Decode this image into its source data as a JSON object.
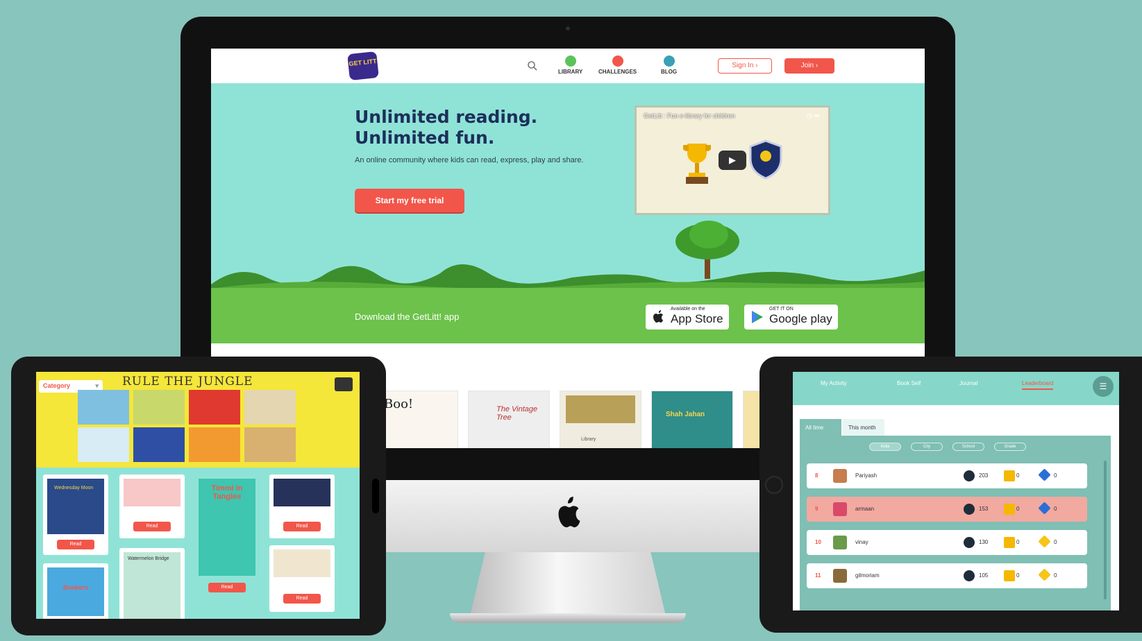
{
  "desktop": {
    "nav": {
      "logo_text": "GET LITT",
      "items": [
        {
          "label": "LIBRARY",
          "color": "#5cc35a"
        },
        {
          "label": "CHALLENGES",
          "color": "#f2564a"
        },
        {
          "label": "BLOG",
          "color": "#3aa0b5"
        }
      ],
      "sign_in": "Sign In ›",
      "join": "Join ›"
    },
    "hero": {
      "title_line1": "Unlimited reading.",
      "title_line2": "Unlimited fun.",
      "subtitle": "An online community where kids can read, express, play and share.",
      "cta": "Start my free trial",
      "video_title": "GetLitt : Fun e-library for children"
    },
    "download": {
      "text": "Download the GetLitt! app",
      "appstore_small": "Available on the",
      "appstore_big": "App Store",
      "googleplay_small": "GET IT ON",
      "googleplay_big": "Google play"
    },
    "book_strip": [
      "Boo!",
      "The Vintage Tree",
      "Library",
      "Shah Jahan",
      ""
    ]
  },
  "tablet_left": {
    "banner_title": "RULE THE JUNGLE",
    "category_label": "Category",
    "read_label": "Read",
    "cards": [
      "Wednesday Moon",
      "",
      "Timmi in Tangles",
      "",
      "Bonkers",
      "Watermelon Bridge",
      ""
    ]
  },
  "tablet_right": {
    "tabs": [
      "My Activity",
      "Book Self",
      "Journal",
      "Leaderboard"
    ],
    "periods": [
      "All time",
      "This month"
    ],
    "filters": [
      "India",
      "City",
      "School",
      "Grade"
    ],
    "rows": [
      {
        "rank": "8",
        "name": "Pariyash",
        "points": "203",
        "trophies": "0",
        "gems": "0",
        "gem_color": "#2b6fd6"
      },
      {
        "rank": "9",
        "name": "armaan",
        "points": "153",
        "trophies": "0",
        "gems": "0",
        "gem_color": "#2b6fd6"
      },
      {
        "rank": "10",
        "name": "vinay",
        "points": "130",
        "trophies": "0",
        "gems": "0",
        "gem_color": "#f5c518"
      },
      {
        "rank": "11",
        "name": "gilmoriam",
        "points": "105",
        "trophies": "0",
        "gems": "0",
        "gem_color": "#f5c518"
      }
    ]
  },
  "colors": {
    "accent": "#f2564a",
    "teal": "#8fe3d6",
    "green": "#6cc24a",
    "background": "#88c5bd"
  }
}
